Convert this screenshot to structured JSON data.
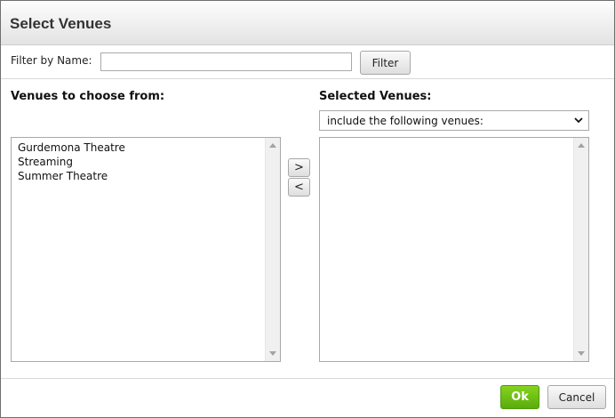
{
  "dialog": {
    "title": "Select Venues"
  },
  "filter": {
    "label": "Filter by Name:",
    "value": "",
    "button_label": "Filter"
  },
  "available": {
    "label": "Venues to choose from:",
    "items": [
      "Gurdemona Theatre",
      "Streaming",
      "Summer Theatre"
    ]
  },
  "selected": {
    "label": "Selected Venues:",
    "mode_option": "include the following venues:",
    "items": []
  },
  "move": {
    "add_label": ">",
    "remove_label": "<"
  },
  "footer": {
    "ok_label": "Ok",
    "cancel_label": "Cancel"
  },
  "colors": {
    "ok_button": "#6cbf12",
    "title_bar": "#e9e9e9",
    "border": "#a9a9a9"
  },
  "icons": {
    "select_arrow": "chevron-down-icon",
    "scroll_up": "scroll-up-icon",
    "scroll_down": "scroll-down-icon"
  }
}
